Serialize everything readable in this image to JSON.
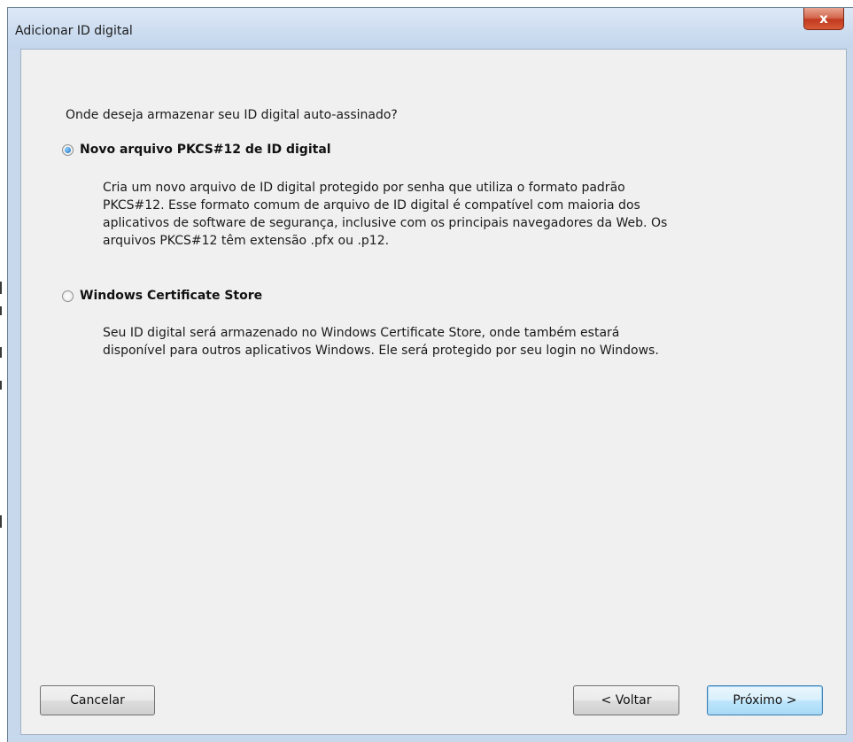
{
  "window": {
    "title": "Adicionar ID digital",
    "close_glyph": "x"
  },
  "content": {
    "question": "Onde deseja armazenar seu ID digital auto-assinado?",
    "options": [
      {
        "label": "Novo arquivo PKCS#12 de ID digital",
        "selected": true,
        "description_lines": [
          "Cria um novo arquivo de ID digital protegido por senha que utiliza o formato padrão",
          "PKCS#12. Esse formato comum de arquivo de ID digital é compatível com maioria dos",
          "aplicativos de software de segurança, inclusive com os principais navegadores da Web. Os",
          "arquivos PKCS#12 têm extensão .pfx ou .p12."
        ]
      },
      {
        "label": "Windows Certificate Store",
        "selected": false,
        "description_lines": [
          "Seu ID digital será armazenado no Windows Certificate Store, onde também estará",
          "disponível para outros aplicativos Windows. Ele será protegido por seu login no Windows."
        ]
      }
    ]
  },
  "buttons": {
    "cancel": "Cancelar",
    "back": "< Voltar",
    "next": "Próximo >"
  },
  "colors": {
    "frame": "#c7d8ec",
    "client_bg": "#f0f0f0",
    "close_red": "#c2391f",
    "default_button_border": "#3c7fb1"
  }
}
